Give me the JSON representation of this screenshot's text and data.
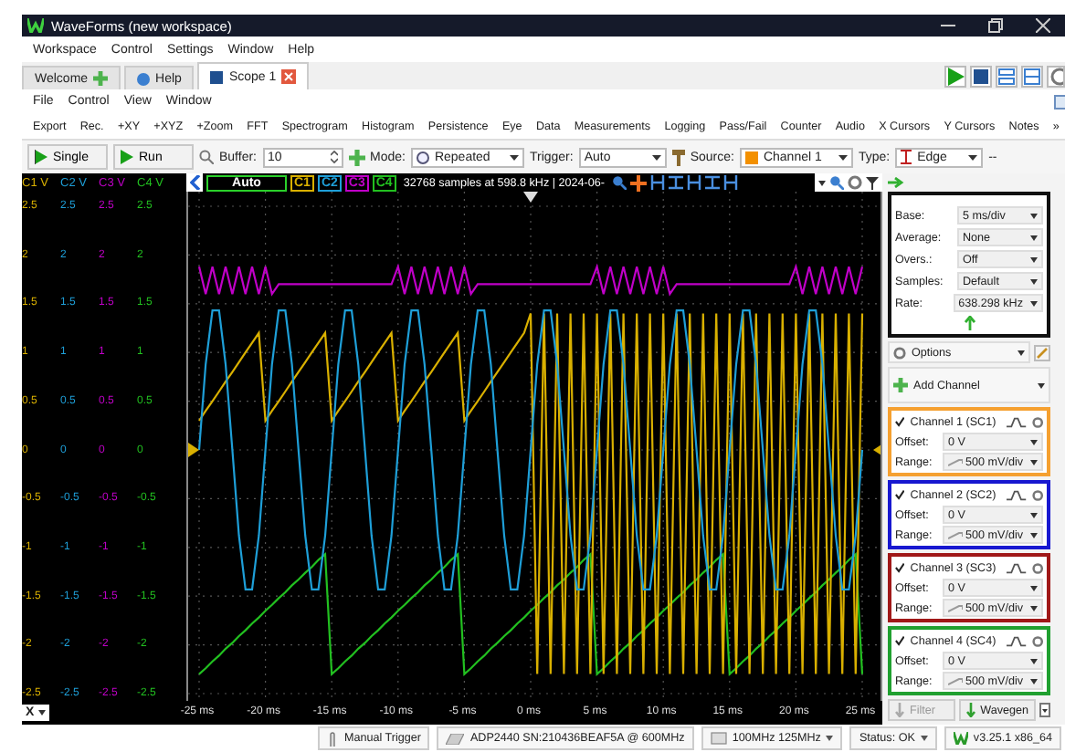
{
  "window": {
    "title": "WaveForms (new workspace)"
  },
  "menu": [
    "Workspace",
    "Control",
    "Settings",
    "Window",
    "Help"
  ],
  "tabs": [
    {
      "label": "Welcome",
      "selected": false,
      "kind": "welcome"
    },
    {
      "label": "Help",
      "selected": false,
      "kind": "help"
    },
    {
      "label": "Scope 1",
      "selected": true,
      "kind": "instrument"
    }
  ],
  "scope_menu": [
    "File",
    "Control",
    "View",
    "Window"
  ],
  "toolbar": [
    "Export",
    "Rec.",
    "+XY",
    "+XYZ",
    "+Zoom",
    "FFT",
    "Spectrogram",
    "Histogram",
    "Persistence",
    "Eye",
    "Data",
    "Measurements",
    "Logging",
    "Pass/Fail",
    "Counter",
    "Audio",
    "X Cursors",
    "Y Cursors",
    "Notes"
  ],
  "toolbar_more": "»",
  "controls": {
    "single": "Single",
    "run": "Run",
    "buffer": {
      "label": "Buffer:",
      "value": "10"
    },
    "mode": {
      "label": "Mode:",
      "value": "Repeated"
    },
    "trigger": {
      "label": "Trigger:",
      "value": "Auto"
    },
    "source": {
      "label": "Source:",
      "value": "Channel 1",
      "color": "#f39000"
    },
    "type": {
      "label": "Type:",
      "value": "Edge"
    },
    "more": "--"
  },
  "display": {
    "status": "Auto",
    "info": "32768 samples at 598.8 kHz | 2024-06-",
    "channel_buttons": [
      {
        "label": "C1",
        "color": "#d9b000"
      },
      {
        "label": "C2",
        "color": "#1e9fd8"
      },
      {
        "label": "C3",
        "color": "#c000c8"
      },
      {
        "label": "C4",
        "color": "#22c020"
      }
    ]
  },
  "y_axes": [
    {
      "header": "C1 V",
      "color": "#d9b000"
    },
    {
      "header": "C2 V",
      "color": "#1e9fd8",
      "ticks": [
        "2.5",
        "2",
        "1.5",
        "1",
        "0.5",
        "0",
        "-0.5",
        "-1",
        "-1.5",
        "-2",
        "-2.5"
      ]
    },
    {
      "header": "C3 V",
      "color": "#c000c8",
      "ticks": [
        "2.5",
        "2",
        "1.5",
        "1",
        "0.5",
        "0",
        "-0.5",
        "-1",
        "-1.5",
        "-2",
        "-2.5"
      ]
    },
    {
      "header": "C4 V",
      "color": "#22c020",
      "ticks": [
        "2.5",
        "2",
        "1.5",
        "1",
        "0.5",
        "0",
        "-0.5",
        "-1",
        "-1.5",
        "-2",
        "-2.5"
      ]
    }
  ],
  "x_axis_button": "X",
  "chart_data": {
    "type": "line",
    "xlim": [
      -25,
      25
    ],
    "ylim": [
      -2.5,
      2.5
    ],
    "grid": true,
    "yticks": [
      {
        "value": 2.5,
        "label": "2.5"
      },
      {
        "value": 2,
        "label": "2"
      },
      {
        "value": 1.5,
        "label": "1.5"
      },
      {
        "value": 1,
        "label": "1"
      },
      {
        "value": 0.5,
        "label": "0.5"
      },
      {
        "value": 0,
        "label": "0"
      },
      {
        "value": -0.5,
        "label": "-0.5"
      },
      {
        "value": -1,
        "label": "-1"
      },
      {
        "value": -1.5,
        "label": "-1.5"
      },
      {
        "value": -2,
        "label": "-2"
      },
      {
        "value": -2.5,
        "label": "-2.5"
      }
    ],
    "xticks": [
      {
        "value": -25,
        "label": "-25 ms"
      },
      {
        "value": -20,
        "label": "-20 ms"
      },
      {
        "value": -15,
        "label": "-15 ms"
      },
      {
        "value": -10,
        "label": "-10 ms"
      },
      {
        "value": -5,
        "label": "-5 ms"
      },
      {
        "value": 0,
        "label": "0 ms"
      },
      {
        "value": 5,
        "label": "5 ms"
      },
      {
        "value": 10,
        "label": "10 ms"
      },
      {
        "value": 15,
        "label": "15 ms"
      },
      {
        "value": 20,
        "label": "20 ms"
      },
      {
        "value": 25,
        "label": "25 ms"
      }
    ],
    "x": [
      -25,
      -24.5,
      -24,
      -23.5,
      -23,
      -22.5,
      -22,
      -21.5,
      -21,
      -20.5,
      -20,
      -19.5,
      -19,
      -18.5,
      -18,
      -17.5,
      -17,
      -16.5,
      -16,
      -15.5,
      -15,
      -14.5,
      -14,
      -13.5,
      -13,
      -12.5,
      -12,
      -11.5,
      -11,
      -10.5,
      -10,
      -9.5,
      -9,
      -8.5,
      -8,
      -7.5,
      -7,
      -6.5,
      -6,
      -5.5,
      -5,
      -4.5,
      -4,
      -3.5,
      -3,
      -2.5,
      -2,
      -1.5,
      -1,
      -0.5,
      0,
      0.5,
      1,
      1.5,
      2,
      2.5,
      3,
      3.5,
      4,
      4.5,
      5,
      5.5,
      6,
      6.5,
      7,
      7.5,
      8,
      8.5,
      9,
      9.5,
      10,
      10.5,
      11,
      11.5,
      12,
      12.5,
      13,
      13.5,
      14,
      14.5,
      15,
      15.5,
      16,
      16.5,
      17,
      17.5,
      18,
      18.5,
      19,
      19.5,
      20,
      20.5,
      21,
      21.5,
      22,
      22.5,
      23,
      23.5,
      24,
      24.5,
      25
    ],
    "series": [
      {
        "color": "#d9b000",
        "values": [
          0.3,
          0.4,
          0.5,
          0.6,
          0.7,
          0.8,
          0.9,
          1,
          1.1,
          1.2,
          0.3,
          0.4,
          0.5,
          0.6,
          0.7,
          0.8,
          0.9,
          1,
          1.1,
          1.2,
          0.3,
          0.4,
          0.5,
          0.6,
          0.7,
          0.8,
          0.9,
          1,
          1.1,
          1.2,
          0.3,
          0.4,
          0.5,
          0.6,
          0.7,
          0.8,
          0.9,
          1,
          1.1,
          1.2,
          0.3,
          0.4,
          0.5,
          0.6,
          0.7,
          0.8,
          0.9,
          1,
          1.1,
          1.2,
          1.4,
          -2.3,
          1.4,
          -2.3,
          1.4,
          -2.3,
          1.4,
          -2.3,
          1.4,
          -2.3,
          1.4,
          -2.3,
          1.4,
          -2.3,
          1.4,
          -2.3,
          1.4,
          -2.3,
          1.4,
          -2.3,
          1.4,
          -2.3,
          1.4,
          -2.3,
          1.4,
          -2.3,
          1.4,
          -2.3,
          1.4,
          -2.3,
          1.4,
          -2.3,
          1.4,
          -2.3,
          1.4,
          -2.3,
          1.4,
          -2.3,
          1.4,
          -2.3,
          1.4,
          -2.3,
          1.4,
          -2.3,
          1.4,
          -2.3,
          1.4,
          -2.3,
          1.4,
          -2.3,
          1.4
        ]
      },
      {
        "color": "#1e9fd8",
        "values": [
          0,
          0.88,
          1.43,
          1.43,
          0.88,
          0,
          -0.88,
          -1.43,
          -1.43,
          -0.88,
          0,
          0.88,
          1.43,
          1.43,
          0.88,
          0,
          -0.88,
          -1.43,
          -1.43,
          -0.88,
          0,
          0.88,
          1.43,
          1.43,
          0.88,
          0,
          -0.88,
          -1.43,
          -1.43,
          -0.88,
          0,
          0.88,
          1.43,
          1.43,
          0.88,
          0,
          -0.88,
          -1.43,
          -1.43,
          -0.88,
          0,
          0.88,
          1.43,
          1.43,
          0.88,
          0,
          -0.88,
          -1.43,
          -1.43,
          -0.88,
          0,
          0.88,
          1.43,
          1.43,
          0.88,
          0,
          -0.88,
          -1.43,
          -1.43,
          -0.88,
          0,
          0.88,
          1.43,
          1.43,
          0.88,
          0,
          -0.88,
          -1.43,
          -1.43,
          -0.88,
          0,
          0.88,
          1.43,
          1.43,
          0.88,
          0,
          -0.88,
          -1.43,
          -1.43,
          -0.88,
          0,
          0.88,
          1.43,
          1.43,
          0.88,
          0,
          -0.88,
          -1.43,
          -1.43,
          -0.88,
          0,
          0.88,
          1.43,
          1.43,
          0.88,
          0,
          -0.88,
          -1.43,
          -1.43,
          -0.88,
          0
        ]
      },
      {
        "color": "#c000c8",
        "values": [
          1.88,
          1.6,
          1.88,
          1.6,
          1.88,
          1.6,
          1.88,
          1.6,
          1.88,
          1.6,
          1.88,
          1.6,
          1.7,
          1.7,
          1.7,
          1.7,
          1.7,
          1.7,
          1.7,
          1.7,
          1.7,
          1.7,
          1.7,
          1.7,
          1.7,
          1.7,
          1.7,
          1.7,
          1.7,
          1.7,
          1.88,
          1.6,
          1.88,
          1.6,
          1.88,
          1.6,
          1.88,
          1.6,
          1.88,
          1.6,
          1.88,
          1.6,
          1.7,
          1.7,
          1.7,
          1.7,
          1.7,
          1.7,
          1.7,
          1.7,
          1.7,
          1.7,
          1.7,
          1.7,
          1.7,
          1.7,
          1.7,
          1.7,
          1.7,
          1.7,
          1.88,
          1.6,
          1.88,
          1.6,
          1.88,
          1.6,
          1.88,
          1.6,
          1.88,
          1.6,
          1.88,
          1.6,
          1.7,
          1.7,
          1.7,
          1.7,
          1.7,
          1.7,
          1.7,
          1.7,
          1.7,
          1.7,
          1.7,
          1.7,
          1.7,
          1.7,
          1.7,
          1.7,
          1.7,
          1.7,
          1.88,
          1.6,
          1.88,
          1.6,
          1.88,
          1.6,
          1.88,
          1.6,
          1.88,
          1.6,
          1.88
        ]
      },
      {
        "color": "#22c020",
        "values": [
          -2.3,
          -2.24,
          -2.17,
          -2.11,
          -2.04,
          -1.98,
          -1.91,
          -1.85,
          -1.78,
          -1.72,
          -1.65,
          -1.59,
          -1.52,
          -1.46,
          -1.39,
          -1.33,
          -1.26,
          -1.2,
          -1.13,
          -1.07,
          -2.3,
          -2.24,
          -2.17,
          -2.11,
          -2.04,
          -1.98,
          -1.91,
          -1.85,
          -1.78,
          -1.72,
          -1.65,
          -1.59,
          -1.52,
          -1.46,
          -1.39,
          -1.33,
          -1.26,
          -1.2,
          -1.13,
          -1.07,
          -2.3,
          -2.24,
          -2.17,
          -2.11,
          -2.04,
          -1.98,
          -1.91,
          -1.85,
          -1.78,
          -1.72,
          -1.65,
          -1.59,
          -1.52,
          -1.46,
          -1.39,
          -1.33,
          -1.26,
          -1.2,
          -1.13,
          -1.07,
          -2.3,
          -2.24,
          -2.17,
          -2.11,
          -2.04,
          -1.98,
          -1.91,
          -1.85,
          -1.78,
          -1.72,
          -1.65,
          -1.59,
          -1.52,
          -1.46,
          -1.39,
          -1.33,
          -1.26,
          -1.2,
          -1.13,
          -1.07,
          -2.3,
          -2.24,
          -2.17,
          -2.11,
          -2.04,
          -1.98,
          -1.91,
          -1.85,
          -1.78,
          -1.72,
          -1.65,
          -1.59,
          -1.52,
          -1.46,
          -1.39,
          -1.33,
          -1.26,
          -1.2,
          -1.13,
          -1.07,
          -2.3
        ]
      }
    ]
  },
  "time": [
    {
      "label": "Base:",
      "value": "5 ms/div"
    },
    {
      "label": "Average:",
      "value": "None"
    },
    {
      "label": "Overs.:",
      "value": "Off"
    },
    {
      "label": "Samples:",
      "value": "Default"
    },
    {
      "label": "Rate:",
      "value": "638.298 kHz"
    }
  ],
  "options": "Options",
  "add_channel": "Add Channel",
  "channels": [
    {
      "name": "Channel 1 (SC1)",
      "checked": true,
      "color": "#f5a030",
      "offset_label": "Offset:",
      "offset": "0 V",
      "range_label": "Range:",
      "range": "500 mV/div"
    },
    {
      "name": "Channel 2 (SC2)",
      "checked": true,
      "color": "#1818d0",
      "offset_label": "Offset:",
      "offset": "0 V",
      "range_label": "Range:",
      "range": "500 mV/div"
    },
    {
      "name": "Channel 3 (SC3)",
      "checked": true,
      "color": "#a01818",
      "offset_label": "Offset:",
      "offset": "0 V",
      "range_label": "Range:",
      "range": "500 mV/div"
    },
    {
      "name": "Channel 4 (SC4)",
      "checked": true,
      "color": "#20a030",
      "offset_label": "Offset:",
      "offset": "0 V",
      "range_label": "Range:",
      "range": "500 mV/div"
    }
  ],
  "bottom_buttons": [
    {
      "label": "Filter",
      "disabled": true
    },
    {
      "label": "Wavegen",
      "disabled": false
    }
  ],
  "status_bar": [
    "Manual Trigger",
    "ADP2440 SN:210436BEAF5A @ 600MHz",
    "100MHz 125MHz",
    "Status: OK",
    "v3.25.1 x86_64"
  ]
}
